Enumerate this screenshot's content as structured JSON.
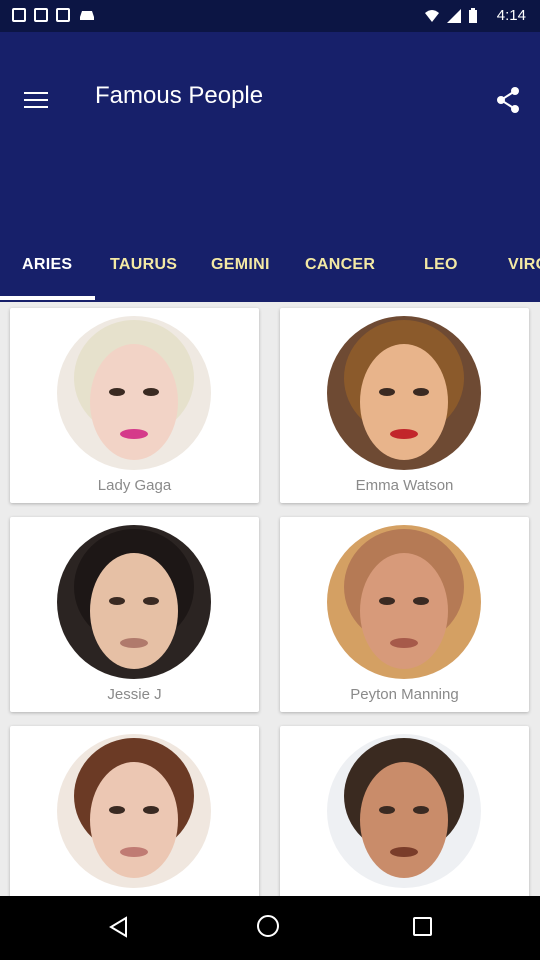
{
  "status_bar": {
    "time": "4:14"
  },
  "app_bar": {
    "title": "Famous People"
  },
  "tabs": [
    {
      "label": "ARIES",
      "active": true
    },
    {
      "label": "TAURUS",
      "active": false
    },
    {
      "label": "GEMINI",
      "active": false
    },
    {
      "label": "CANCER",
      "active": false
    },
    {
      "label": "LEO",
      "active": false
    },
    {
      "label": "VIRGO",
      "active": false
    }
  ],
  "people": [
    {
      "name": "Lady Gaga",
      "skin": "#f2d3c6",
      "hair": "#e6e1cc",
      "bg": "#efe9e2",
      "lip": "#d53a8a"
    },
    {
      "name": "Emma Watson",
      "skin": "#e8b48b",
      "hair": "#8b5a2b",
      "bg": "#6e4a33",
      "lip": "#c2262b"
    },
    {
      "name": "Jessie J",
      "skin": "#e6c0a5",
      "hair": "#1d1716",
      "bg": "#2b2422",
      "lip": "#b07a6c"
    },
    {
      "name": "Peyton Manning",
      "skin": "#d79a7a",
      "hair": "#b57a55",
      "bg": "#d4a063",
      "lip": "#a65a4a"
    },
    {
      "name": "",
      "skin": "#ecc7b3",
      "hair": "#6b3a25",
      "bg": "#f0e7df",
      "lip": "#c07b73"
    },
    {
      "name": "",
      "skin": "#c98c6a",
      "hair": "#3a2a20",
      "bg": "#eef0f3",
      "lip": "#7a3d2a"
    }
  ],
  "colors": {
    "app_bar": "#17206a",
    "tab_inactive": "#f3e9a4",
    "tab_active": "#ffffff",
    "background": "#ececec"
  }
}
